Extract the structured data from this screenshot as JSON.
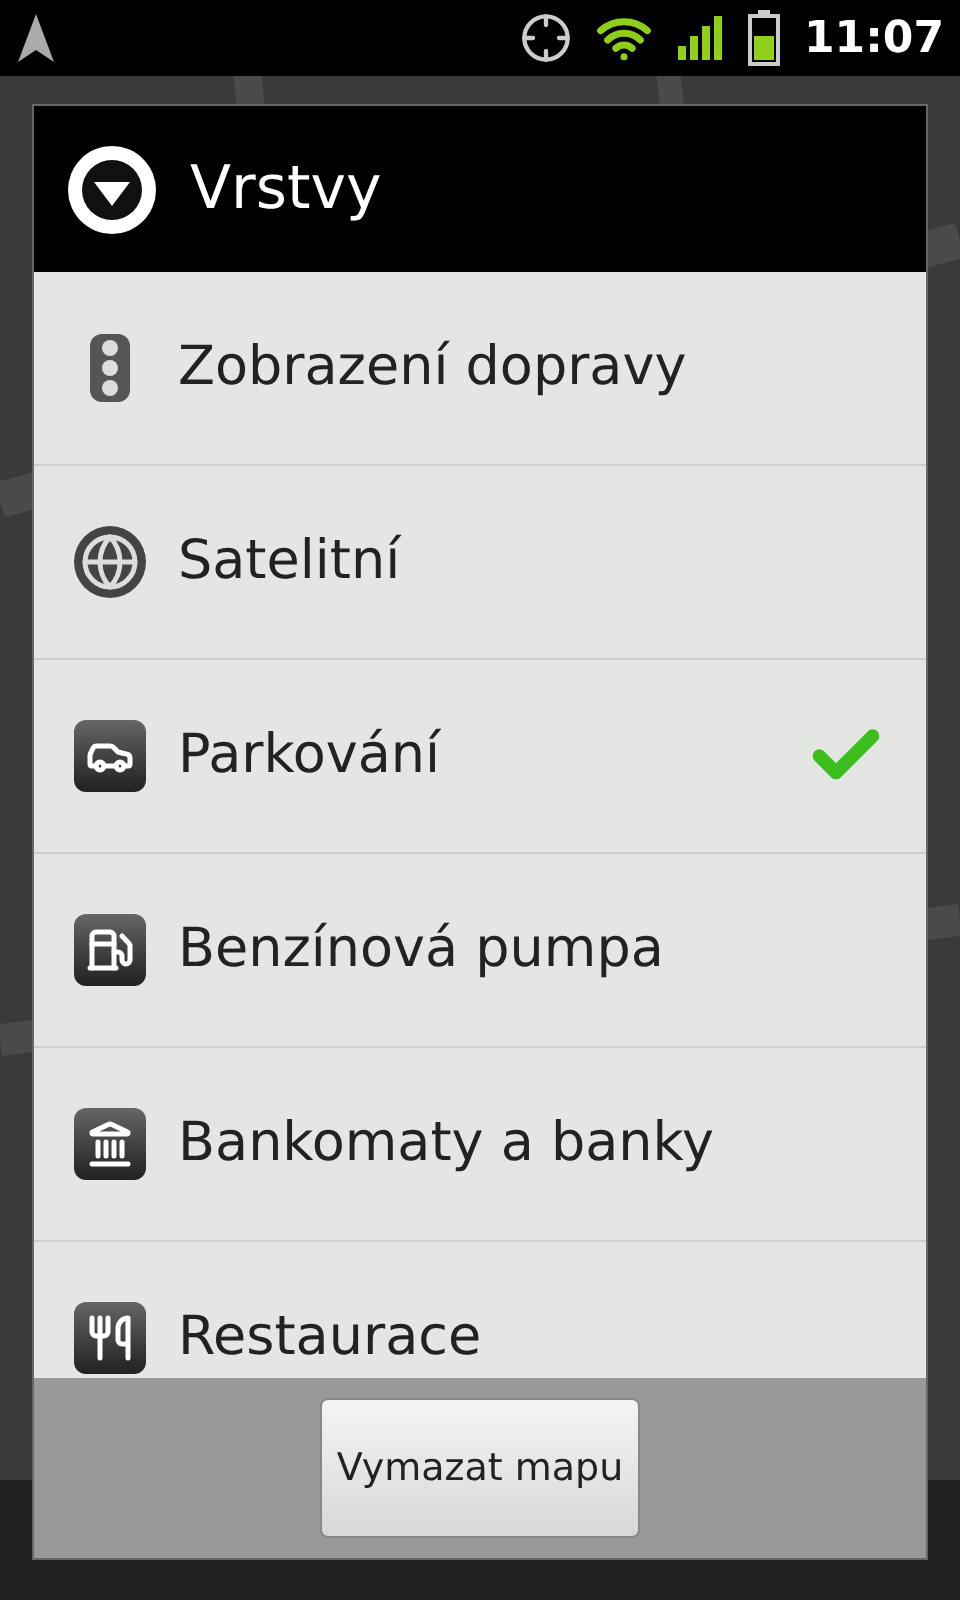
{
  "status_bar": {
    "time": "11:07"
  },
  "dialog": {
    "title": "Vrstvy",
    "items": [
      {
        "kind": "traffic",
        "label": "Zobrazení dopravy",
        "checked": false
      },
      {
        "kind": "satellite",
        "label": "Satelitní",
        "checked": false
      },
      {
        "kind": "parking",
        "label": "Parkování",
        "checked": true
      },
      {
        "kind": "fuel",
        "label": "Benzínová pumpa",
        "checked": false
      },
      {
        "kind": "bank",
        "label": "Bankomaty a banky",
        "checked": false
      },
      {
        "kind": "restaurant",
        "label": "Restaurace",
        "checked": false
      }
    ],
    "button": "Vymazat mapu"
  }
}
